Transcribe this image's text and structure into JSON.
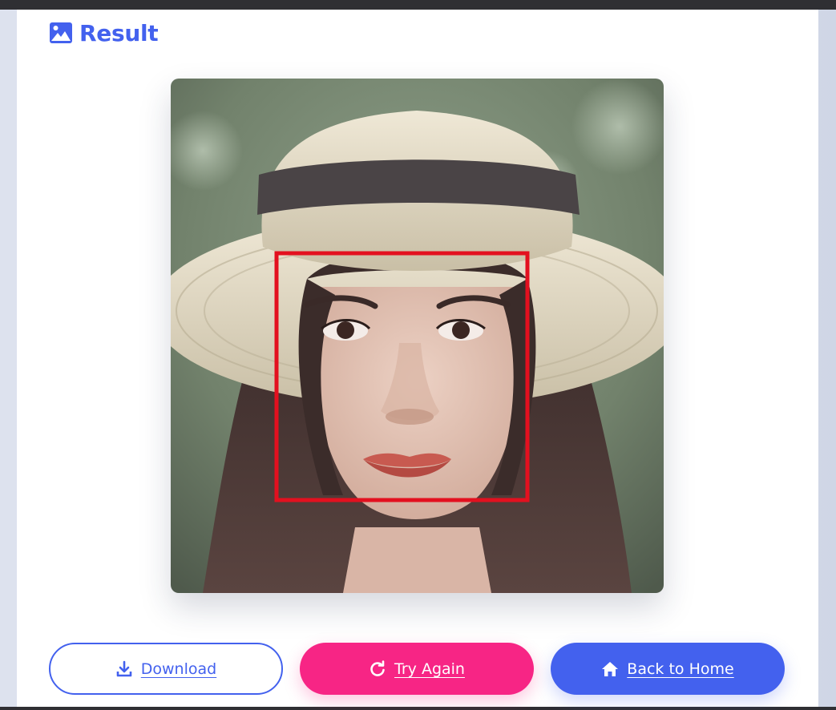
{
  "result": {
    "title": "Result",
    "title_icon": "image-icon",
    "image_alt": "Face detection result",
    "detection_box_color": "#e3101f"
  },
  "actions": {
    "download": {
      "label": "Download",
      "icon": "download-icon"
    },
    "try_again": {
      "label": "Try Again",
      "icon": "redo-icon"
    },
    "home": {
      "label": "Back to Home",
      "icon": "home-icon"
    }
  },
  "colors": {
    "primary": "#4361ee",
    "secondary": "#f72585",
    "card": "#ffffff"
  }
}
